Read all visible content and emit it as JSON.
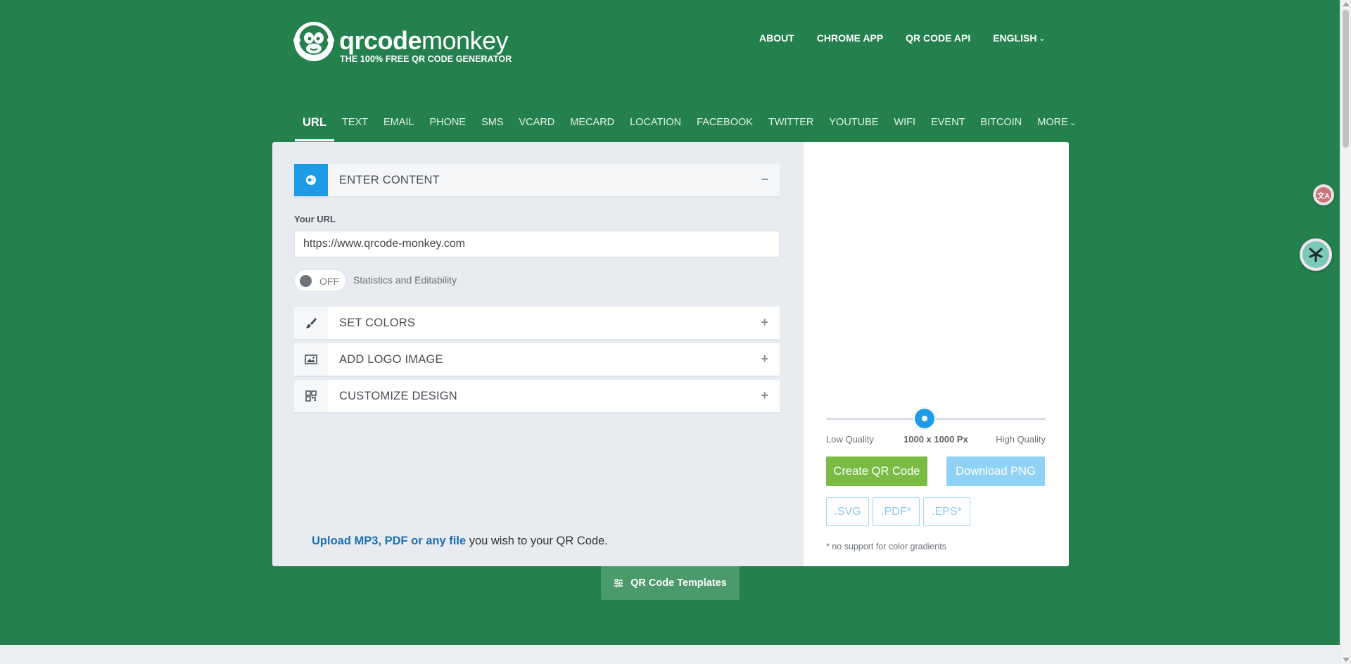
{
  "brand": {
    "name_bold": "qrcode",
    "name_light": "monkey",
    "tagline": "THE 100% FREE QR CODE GENERATOR"
  },
  "topnav": {
    "about": "ABOUT",
    "chrome_app": "CHROME APP",
    "api": "QR CODE API",
    "language": "ENGLISH"
  },
  "tabs": [
    {
      "label": "URL",
      "active": true
    },
    {
      "label": "TEXT"
    },
    {
      "label": "EMAIL"
    },
    {
      "label": "PHONE"
    },
    {
      "label": "SMS"
    },
    {
      "label": "VCARD"
    },
    {
      "label": "MECARD"
    },
    {
      "label": "LOCATION"
    },
    {
      "label": "FACEBOOK"
    },
    {
      "label": "TWITTER"
    },
    {
      "label": "YOUTUBE"
    },
    {
      "label": "WIFI"
    },
    {
      "label": "EVENT"
    },
    {
      "label": "BITCOIN"
    },
    {
      "label": "MORE"
    }
  ],
  "content": {
    "enter_content": "ENTER CONTENT",
    "url_label": "Your URL",
    "url_value": "https://www.qrcode-monkey.com",
    "toggle_state": "OFF",
    "toggle_label": "Statistics and Editability",
    "set_colors": "SET COLORS",
    "add_logo": "ADD LOGO IMAGE",
    "customize": "CUSTOMIZE DESIGN",
    "upload_link": "Upload MP3, PDF or any file",
    "upload_rest": " you wish to your QR Code."
  },
  "output": {
    "low_quality": "Low Quality",
    "high_quality": "High Quality",
    "size": "1000 x 1000 Px",
    "slider_fraction": 0.45,
    "create_btn": "Create QR Code",
    "download_btn": "Download PNG",
    "fmt_svg": ".SVG",
    "fmt_pdf": ".PDF*",
    "fmt_eps": ".EPS*",
    "gradient_note": "* no support for color gradients"
  },
  "templates_btn": "QR Code Templates",
  "colors": {
    "background": "#24814e",
    "accent_blue": "#1e9be6",
    "create_green": "#79bb43",
    "download_blue": "#8fd2f5"
  }
}
